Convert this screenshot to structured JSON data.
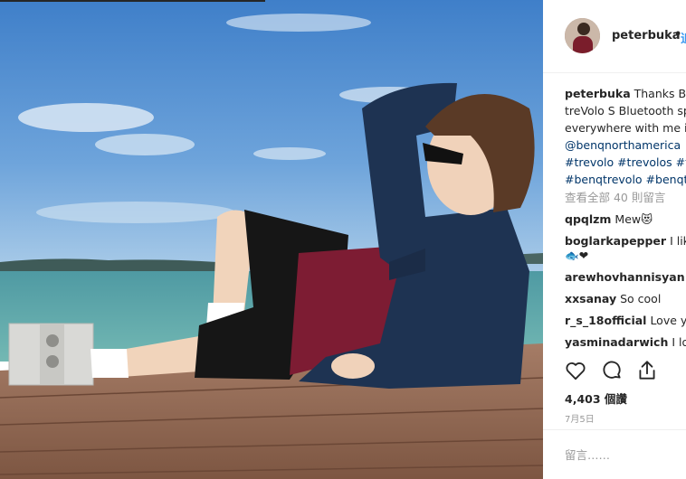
{
  "post": {
    "username": "peterbuka",
    "follow_label": "追蹤",
    "dot": "•"
  },
  "caption": {
    "username": "peterbuka",
    "line1": "Thanks BenQ",
    "line2": "treVolo S Bluetooth sp",
    "line3": "everywhere with me in",
    "mention": "@benqnorthamerica",
    "tags1": "#trevolo #trevolos #tr",
    "tags2": "#benqtrevolo #benqt"
  },
  "view_all": "查看全部 40 則留言",
  "comments": [
    {
      "user": "qpqlzm",
      "text": "Mew😻"
    },
    {
      "user": "boglarkapepper",
      "text": "I like",
      "text2": "🐟❤"
    },
    {
      "user": "arewhovhannisyan",
      "text": "❤"
    },
    {
      "user": "xxsanay",
      "text": "So cool"
    },
    {
      "user": "r_s_18official",
      "text": "Love yo"
    },
    {
      "user": "yasminadarwich",
      "text": "I love"
    }
  ],
  "actions": {
    "like_icon": "heart-icon",
    "comment_icon": "comment-icon",
    "share_icon": "share-icon"
  },
  "likes": "4,403 個讚",
  "date": "7月5日",
  "add_comment": {
    "placeholder": "留言……"
  },
  "colors": {
    "link": "#003569",
    "follow": "#3897f0",
    "muted": "#999999"
  }
}
